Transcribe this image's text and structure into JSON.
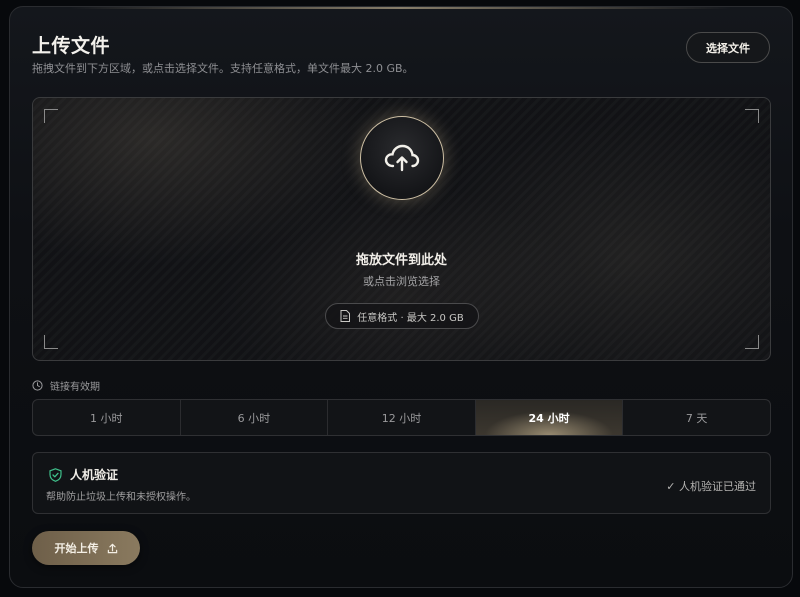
{
  "header": {
    "title": "上传文件",
    "subtitle": "拖拽文件到下方区域，或点击选择文件。支持任意格式，单文件最大 2.0 GB。",
    "choose_button": "选择文件"
  },
  "dropzone": {
    "icon": "cloud-upload-icon",
    "title": "拖放文件到此处",
    "subtitle": "或点击浏览选择",
    "format_pill": "任意格式 · 最大 2.0 GB"
  },
  "expiry": {
    "label": "链接有效期",
    "options": [
      "1 小时",
      "6 小时",
      "12 小时",
      "24 小时",
      "7 天"
    ],
    "selected": "24 小时"
  },
  "captcha": {
    "title": "人机验证",
    "description": "帮助防止垃圾上传和未授权操作。",
    "status": "✓ 人机验证已通过"
  },
  "actions": {
    "start_upload": "开始上传"
  },
  "colors": {
    "accent_gold": "#cdbfa4",
    "shield_green": "#3fbf8a",
    "background": "#0b0d10"
  }
}
